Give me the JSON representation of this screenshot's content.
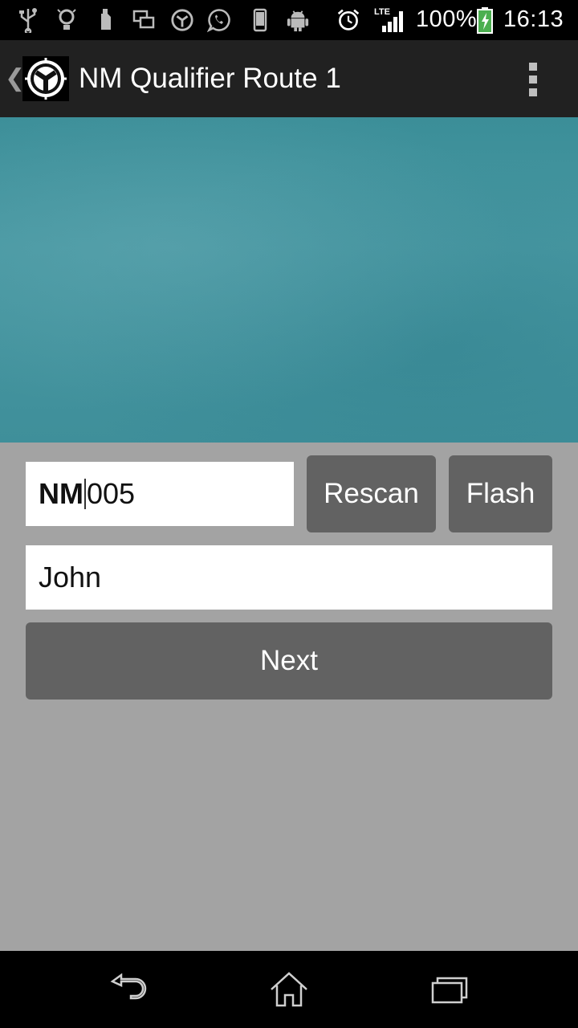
{
  "status_bar": {
    "network_label": "LTE",
    "battery_text": "100%",
    "time": "16:13",
    "icons": [
      "usb-icon",
      "lightbulb-icon",
      "sd-card-icon",
      "screen-mirror-icon",
      "app-logo-icon",
      "whatsapp-icon",
      "phone-icon",
      "android-icon",
      "alarm-icon",
      "signal-icon",
      "battery-icon"
    ]
  },
  "action_bar": {
    "title": "NM Qualifier Route 1",
    "up_icon": "chevron-left-icon",
    "logo_icon": "app-logo-icon",
    "overflow_icon": "overflow-menu-icon"
  },
  "form": {
    "code_prefix": "NM",
    "code_suffix": "005",
    "name_value": "John",
    "rescan_label": "Rescan",
    "flash_label": "Flash",
    "next_label": "Next"
  },
  "nav_bar": {
    "icons": [
      "back-icon",
      "home-icon",
      "recent-apps-icon"
    ]
  },
  "colors": {
    "background": "#a3a3a3",
    "action_bar": "#212121",
    "button": "#626262",
    "camera_preview": "#4595a0"
  }
}
